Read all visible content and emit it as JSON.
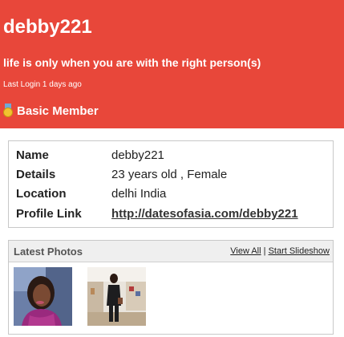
{
  "profile": {
    "username": "debby221",
    "tagline": "life is only when you are with the right person(s)",
    "last_login": "Last Login 1 days ago",
    "membership": "Basic Member"
  },
  "details": {
    "rows": [
      {
        "label": "Name",
        "value": "debby221"
      },
      {
        "label": "Details",
        "value": "23 years old , Female"
      },
      {
        "label": "Location",
        "value": "delhi India"
      },
      {
        "label": "Profile Link",
        "value": "http://datesofasia.com/debby221"
      }
    ]
  },
  "photos": {
    "title": "Latest Photos",
    "view_all": "View All",
    "separator": "|",
    "start_slideshow": "Start Slideshow"
  },
  "colors": {
    "header_bg": "#e8473a",
    "panel_border": "#c8c8c8"
  }
}
